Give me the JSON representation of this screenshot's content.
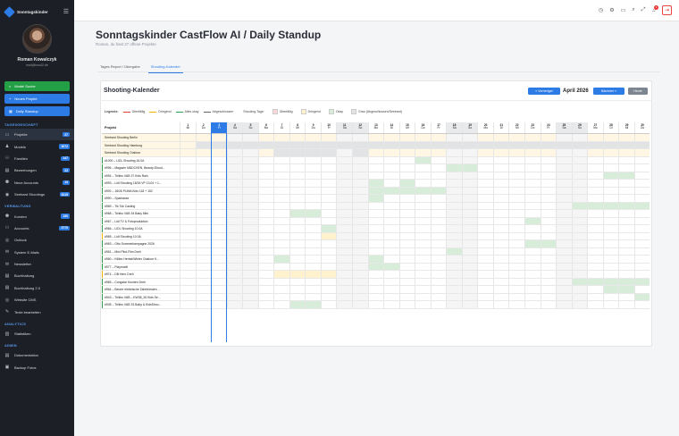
{
  "brand": "Sonntagskinder",
  "user": {
    "name": "Roman Kowalczyk",
    "email": "mail@bos42.de"
  },
  "quick": [
    {
      "label": "Model Suche",
      "color": "green"
    },
    {
      "label": "Neues Projekt",
      "color": "blue"
    },
    {
      "label": "Daily Standup",
      "color": "blue"
    }
  ],
  "sections": [
    {
      "title": "TAGESGESCHÄFT",
      "items": [
        {
          "label": "Projekte",
          "badge": "27",
          "icon": "▭",
          "active": true
        },
        {
          "label": "Models",
          "badge": "3072",
          "icon": "♟"
        },
        {
          "label": "Familien",
          "badge": "147",
          "icon": "⚇"
        },
        {
          "label": "Bewerbungen",
          "badge": "22",
          "icon": "▤"
        },
        {
          "label": "Neue Accounts",
          "badge": "13",
          "icon": "⚉"
        },
        {
          "label": "Seebard Shootings",
          "badge": "6119",
          "icon": "◉"
        }
      ]
    },
    {
      "title": "VERWALTUNG",
      "items": [
        {
          "label": "Kunden",
          "badge": "150",
          "icon": "⚉"
        },
        {
          "label": "Accounts",
          "badge": "3770",
          "icon": "⚇"
        },
        {
          "label": "Outlook",
          "badge": "",
          "icon": "◎"
        },
        {
          "label": "System E-Mails",
          "badge": "",
          "icon": "✉"
        },
        {
          "label": "Newsletter",
          "badge": "",
          "icon": "✉"
        },
        {
          "label": "Buchhaltung",
          "badge": "",
          "icon": "▤"
        },
        {
          "label": "Buchhaltung 2.0",
          "badge": "",
          "icon": "▤"
        },
        {
          "label": "Website CMS",
          "badge": "",
          "icon": "◎"
        },
        {
          "label": "Texte bearbeiten",
          "badge": "",
          "icon": "✎"
        }
      ]
    },
    {
      "title": "ANALYTICS",
      "items": [
        {
          "label": "Statistiken",
          "badge": "",
          "icon": "▥"
        }
      ]
    },
    {
      "title": "ADMIN",
      "items": [
        {
          "label": "Dokumentation",
          "badge": "",
          "icon": "▤"
        },
        {
          "label": "Backup Fotos",
          "badge": "",
          "icon": "▣"
        }
      ]
    }
  ],
  "topbar": {
    "notifications": "3"
  },
  "page": {
    "title": "Sonntagskinder CastFlow AI / Daily Standup",
    "subtitle": "Roman, du hast 27 offene Projekte"
  },
  "tabs": [
    {
      "label": "Tages Report / Übergabe",
      "active": false
    },
    {
      "label": "Shooting-Kalender",
      "active": true
    }
  ],
  "calendar": {
    "title": "Shooting-Kalender",
    "prev": "« Vorheriger",
    "month": "April 2026",
    "next": "Nächster »",
    "today": "Heute",
    "project_header": "Projekt"
  },
  "legend": {
    "title": "Legende:",
    "lines": [
      {
        "label": "Überfällig",
        "color": "#e53935"
      },
      {
        "label": "Dringend",
        "color": "#f0b400"
      },
      {
        "label": "Alles okay",
        "color": "#2e9e4f"
      },
      {
        "label": "Abgeschlossen",
        "color": "#666666"
      }
    ],
    "shoot_title": "Shooting-Tage:",
    "squares": [
      {
        "label": "Überfällig",
        "color": "#f9d6d8"
      },
      {
        "label": "Dringend",
        "color": "#fff2cc"
      },
      {
        "label": "Okay",
        "color": "#d7ecd9"
      },
      {
        "label": "Grau (Abgeschlossen/Seebard)",
        "color": "#e2e3e5"
      }
    ]
  },
  "days": [
    [
      "1",
      "Mi"
    ],
    [
      "2",
      "Do"
    ],
    [
      "3",
      "Fr"
    ],
    [
      "4",
      "Sa"
    ],
    [
      "5",
      "So"
    ],
    [
      "6",
      "Mo"
    ],
    [
      "7",
      "Di"
    ],
    [
      "8",
      "Mi"
    ],
    [
      "9",
      "Do"
    ],
    [
      "10",
      "Fr"
    ],
    [
      "11",
      "Sa"
    ],
    [
      "12",
      "So"
    ],
    [
      "13",
      "Mo"
    ],
    [
      "14",
      "Di"
    ],
    [
      "15",
      "Mi"
    ],
    [
      "16",
      "Do"
    ],
    [
      "17",
      "Fr"
    ],
    [
      "18",
      "Sa"
    ],
    [
      "19",
      "So"
    ],
    [
      "20",
      "Mo"
    ],
    [
      "21",
      "Di"
    ],
    [
      "22",
      "Mi"
    ],
    [
      "23",
      "Do"
    ],
    [
      "24",
      "Fr"
    ],
    [
      "25",
      "Sa"
    ],
    [
      "26",
      "So"
    ],
    [
      "27",
      "Mo"
    ],
    [
      "28",
      "Di"
    ],
    [
      "29",
      "Mi"
    ],
    [
      "30",
      "Do"
    ]
  ],
  "today_index": 2,
  "rows": [
    {
      "name": "Seebard Shooting Berlin",
      "status": "seebard",
      "cells": "............................."
    },
    {
      "name": "Seebard Shooting Hamburg",
      "status": "seebard",
      "cells": ".gggggggggggggggggggggggggggggg"
    },
    {
      "name": "Seebard Shooting Outdoor",
      "status": "seebard",
      "cells": "......gggg.g..................."
    },
    {
      "name": "#1000 – LIDL Shooting 16.0A",
      "status": "ok",
      "cells": "...............o.............."
    },
    {
      "name": "#996 – Magazin MÄDCHEN, Beauty-Shoot...",
      "status": "ok",
      "cells": ".................oo..........."
    },
    {
      "name": "#994 – Tchibo VAB 37 Kids Rain",
      "status": "ok",
      "cells": "...........................oo."
    },
    {
      "name": "#993 – Lidl Shooting 18/26 VP 13.04 + 1...",
      "status": "ok",
      "cells": "............o.o..............."
    },
    {
      "name": "#992 – 18/26 PUMA Kids 118 + 152",
      "status": "ok",
      "cells": "............ooooo............."
    },
    {
      "name": "#990 – Sparkasse",
      "status": "ok",
      "cells": "............o.................."
    },
    {
      "name": "#969 – Tik Tok Casting",
      "status": "ok",
      "cells": ".........................ooooo"
    },
    {
      "name": "#968 – Tchibo VAB 34 Baby Mini",
      "status": "ok",
      "cells": ".......oo....................."
    },
    {
      "name": "#967 – Lidl TV & Fotoproduktion",
      "status": "ok",
      "cells": "......................o......."
    },
    {
      "name": "#966 – LIDL Shooting 10.0A",
      "status": "ok",
      "cells": ".........o...................."
    },
    {
      "name": "#965 – Lidl Shooting 10.0A",
      "status": "due",
      "cells": ".........d...................."
    },
    {
      "name": "#963 – Otto Sommerkampagne 2026",
      "status": "ok",
      "cells": "......................oo......"
    },
    {
      "name": "#961 – Mini Pilot-Film Dreh",
      "status": "ok",
      "cells": ".................o............"
    },
    {
      "name": "#960 – Killtec Herbst/Winter Outdoor K...",
      "status": "ok",
      "cells": "......o.....o.................."
    },
    {
      "name": "#977 – Playmobil",
      "status": "ok",
      "cells": "............oo................"
    },
    {
      "name": "#974 – DB Hero Dreh",
      "status": "due",
      "cells": "......dddd...................."
    },
    {
      "name": "#965 – Congstar Kunden Dreh",
      "status": "ok",
      "cells": ".........................ooooo"
    },
    {
      "name": "#964 – Beurer elektrische Zahnbürsten ...",
      "status": "ok",
      "cells": "...........................oo."
    },
    {
      "name": "#943 – Tchibo VAB – KW38_26 Kids Se...",
      "status": "ok",
      "cells": ".............................o"
    },
    {
      "name": "#935 – Tchibo VAB 33 Baby & KidsShoo...",
      "status": "ok",
      "cells": ".......oo....................."
    }
  ]
}
